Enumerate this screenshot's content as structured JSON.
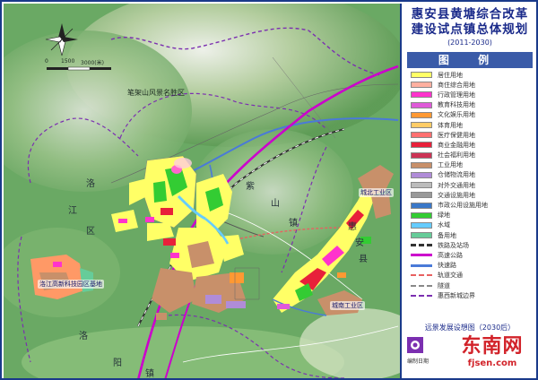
{
  "title": {
    "line1": "惠安县黄塘综合改革",
    "line2": "建设试点镇总体规划",
    "years": "(2011-2030)"
  },
  "legend": {
    "heading": "图 例",
    "items": [
      {
        "label": "居住用地",
        "color": "#ffff66",
        "kind": "fill"
      },
      {
        "label": "商住综合用地",
        "color": "#ffb0a0",
        "kind": "fill"
      },
      {
        "label": "行政管理用地",
        "color": "#ff33cc",
        "kind": "fill"
      },
      {
        "label": "教育科技用地",
        "color": "#e05ad9",
        "kind": "fill"
      },
      {
        "label": "文化娱乐用地",
        "color": "#ff9933",
        "kind": "fill"
      },
      {
        "label": "体育用地",
        "color": "#ffcc66",
        "kind": "fill"
      },
      {
        "label": "医疗保健用地",
        "color": "#ff7070",
        "kind": "fill"
      },
      {
        "label": "商业金融用地",
        "color": "#e8203a",
        "kind": "fill"
      },
      {
        "label": "社会福利用地",
        "color": "#cc3355",
        "kind": "fill"
      },
      {
        "label": "工业用地",
        "color": "#c8906a",
        "kind": "fill"
      },
      {
        "label": "仓储物流用地",
        "color": "#b08cd8",
        "kind": "fill"
      },
      {
        "label": "对外交通用地",
        "color": "#bcbcbc",
        "kind": "fill"
      },
      {
        "label": "交通设施用地",
        "color": "#999999",
        "kind": "fill"
      },
      {
        "label": "市政公用设施用地",
        "color": "#3a78c8",
        "kind": "fill"
      },
      {
        "label": "绿地",
        "color": "#33cc33",
        "kind": "fill"
      },
      {
        "label": "水域",
        "color": "#66ccff",
        "kind": "fill"
      },
      {
        "label": "备用地",
        "color": "#66cc99",
        "kind": "fill"
      },
      {
        "label": "铁路及站场",
        "color": "#333333",
        "kind": "rail"
      },
      {
        "label": "高速公路",
        "color": "#cc00cc",
        "kind": "line"
      },
      {
        "label": "快速路",
        "color": "#4a7ad8",
        "kind": "line"
      },
      {
        "label": "轨道交通",
        "color": "#e86060",
        "kind": "dash"
      },
      {
        "label": "隧道",
        "color": "#888888",
        "kind": "dash"
      },
      {
        "label": "惠西新城边界",
        "color": "#7b2fb0",
        "kind": "dash"
      }
    ]
  },
  "map_labels": {
    "scenic_area": "笔架山风景名胜区",
    "luo": "洛",
    "jiang": "江",
    "qu": "区",
    "zi": "紫",
    "shan": "山",
    "zhen": "镇",
    "hui": "惠",
    "an": "安",
    "xian": "县",
    "yang": "阳",
    "luo2": "洛",
    "zhen2": "镇",
    "hi_tech_base": "洛江高新科技园区基地",
    "north_industrial": "城北工业区",
    "south_industrial": "城南工业区"
  },
  "scale_bar": {
    "t0": "0",
    "t1": "1500",
    "t2": "3000(米)"
  },
  "far_vision": "远景发展设想图（2030后）",
  "editor": "编制日期",
  "watermark": {
    "cn": "东南网",
    "en": "fjsen.com"
  }
}
